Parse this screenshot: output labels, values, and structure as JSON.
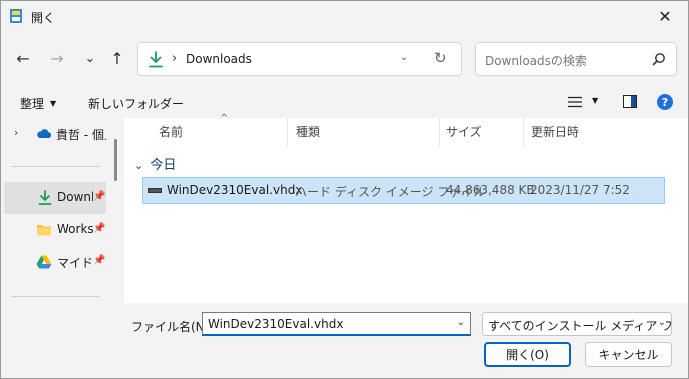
{
  "window": {
    "title": "開く"
  },
  "nav": {
    "back": "←",
    "forward": "→",
    "recent": "⌄",
    "up": "↑"
  },
  "address": {
    "separator": "›",
    "location": "Downloads",
    "dropdown": "⌄",
    "refresh": "↻"
  },
  "search": {
    "placeholder": "Downloadsの検索"
  },
  "toolbar": {
    "organize": "整理",
    "new_folder": "新しいフォルダー",
    "help": "?"
  },
  "sidebar": {
    "items": [
      {
        "label": "貴哲 - 個人用"
      },
      {
        "label": "Downloads"
      },
      {
        "label": "Works"
      },
      {
        "label": "マイドライブ"
      }
    ]
  },
  "columns": {
    "name": "名前",
    "type": "種類",
    "size": "サイズ",
    "modified": "更新日時"
  },
  "group": {
    "label": "今日"
  },
  "files": [
    {
      "name": "WinDev2310Eval.vhdx",
      "type": "ハード ディスク イメージ ファイル",
      "size": "44,863,488 KB",
      "modified": "2023/11/27 7:52"
    }
  ],
  "footer": {
    "filename_label": "ファイル名(N):",
    "filename_value": "WinDev2310Eval.vhdx",
    "filetype": "すべてのインストール メディア ファイル",
    "open_label": "開く(O)",
    "cancel_label": "キャンセル"
  },
  "colors": {
    "accent": "#0067c0",
    "selection": "#cce4f7",
    "download_green": "#1a9e5c"
  }
}
